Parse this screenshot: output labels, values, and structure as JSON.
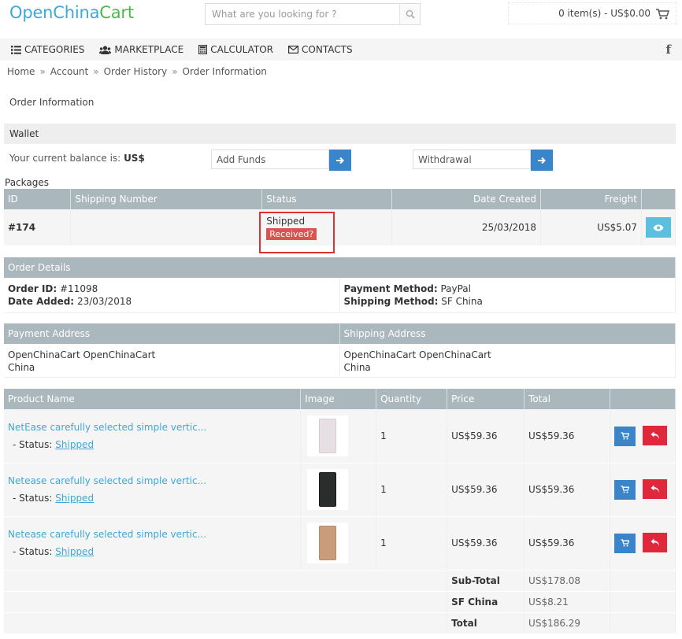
{
  "brand": {
    "part1": "OpenChina",
    "part2": "Cart"
  },
  "search": {
    "placeholder": "What are you looking for ?"
  },
  "cart": {
    "summary": "0 item(s) - US$0.00"
  },
  "nav": [
    {
      "label": "CATEGORIES",
      "icon": "list-icon"
    },
    {
      "label": "MARKETPLACE",
      "icon": "users-icon"
    },
    {
      "label": "CALCULATOR",
      "icon": "calculator-icon"
    },
    {
      "label": "CONTACTS",
      "icon": "envelope-icon"
    }
  ],
  "social": {
    "facebook": "f"
  },
  "breadcrumb": [
    "Home",
    "Account",
    "Order History",
    "Order Information"
  ],
  "breadcrumb_sep": "»",
  "page_title": "Order Information",
  "wallet": {
    "heading": "Wallet",
    "balance_label": "Your current balance is:",
    "balance_value": "US$",
    "add_funds_placeholder": "Add Funds",
    "withdrawal_placeholder": "Withdrawal"
  },
  "packages": {
    "label": "Packages",
    "headers": {
      "id": "ID",
      "shipping_number": "Shipping Number",
      "status": "Status",
      "date_created": "Date Created",
      "freight": "Freight"
    },
    "row": {
      "id": "#174",
      "shipping_number": "",
      "status": "Shipped",
      "received_label": "Received?",
      "date_created": "25/03/2018",
      "freight": "US$5.07"
    }
  },
  "order_details": {
    "heading": "Order Details",
    "order_id_label": "Order ID:",
    "order_id": "#11098",
    "date_added_label": "Date Added:",
    "date_added": "23/03/2018",
    "payment_method_label": "Payment Method:",
    "payment_method": "PayPal",
    "shipping_method_label": "Shipping Method:",
    "shipping_method": "SF China"
  },
  "addresses": {
    "payment_heading": "Payment Address",
    "shipping_heading": "Shipping Address",
    "payment_line1": "OpenChinaCart OpenChinaCart",
    "payment_line2": "China",
    "shipping_line1": "OpenChinaCart OpenChinaCart",
    "shipping_line2": "China"
  },
  "products": {
    "headers": {
      "name": "Product Name",
      "image": "Image",
      "quantity": "Quantity",
      "price": "Price",
      "total": "Total"
    },
    "status_label": "- Status:",
    "items": [
      {
        "name": "NetEase carefully selected simple vertic...",
        "status": "Shipped",
        "quantity": "1",
        "price": "US$59.36",
        "total": "US$59.36",
        "color": "#e8dfe4"
      },
      {
        "name": "Netease carefully selected simple vertic...",
        "status": "Shipped",
        "quantity": "1",
        "price": "US$59.36",
        "total": "US$59.36",
        "color": "#2a2d2c"
      },
      {
        "name": "Netease carefully selected simple vertic...",
        "status": "Shipped",
        "quantity": "1",
        "price": "US$59.36",
        "total": "US$59.36",
        "color": "#c99c7b"
      }
    ],
    "totals": [
      {
        "label": "Sub-Total",
        "value": "US$178.08"
      },
      {
        "label": "SF China",
        "value": "US$8.21"
      },
      {
        "label": "Total",
        "value": "US$186.29"
      }
    ]
  }
}
